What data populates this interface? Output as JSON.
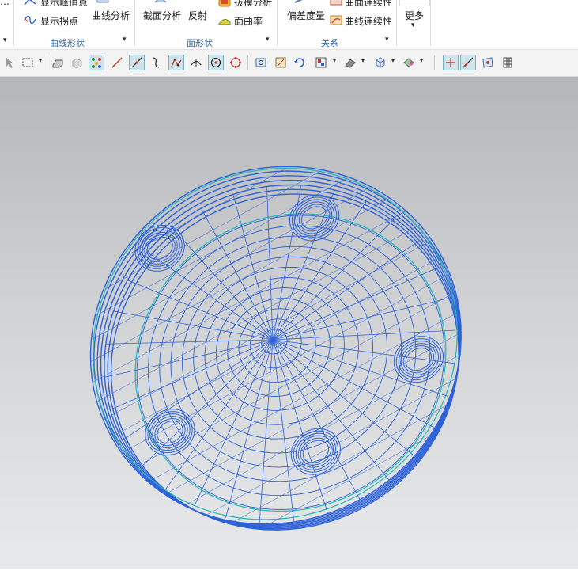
{
  "ribbon": {
    "curve_shape_group": {
      "item_peak": "显示峰值点",
      "item_inflection": "显示拐点",
      "btn_curve_analysis": "曲线分析",
      "label": "曲线形状"
    },
    "face_shape_group": {
      "btn_section": "截面分析",
      "btn_reflection": "反射",
      "item_draft": "拔模分析",
      "item_curvature": "面曲率",
      "label": "面形状"
    },
    "relation_group": {
      "btn_deviation": "偏差度量",
      "item_face_continuity": "曲面连续性",
      "item_curve_continuity": "曲线连续性",
      "label": "关系"
    },
    "more_label": "更多"
  },
  "toolbar": {
    "icons": [
      "select-arrow-icon",
      "box-select-icon",
      "shaded-edges-icon",
      "shaded-icon",
      "show-snap-icon",
      "line-icon",
      "line-tool-icon",
      "curve-icon",
      "curve-points-icon",
      "intersection-icon",
      "center-point-icon",
      "quadrant-point-icon",
      "zoom-fit-icon",
      "view-icon",
      "rotate-icon",
      "layer-icon",
      "edit-object-icon",
      "cube-view-icon",
      "render-style-icon",
      "crosshair-icon",
      "snap-line-icon",
      "perspective-icon",
      "grid-icon"
    ]
  },
  "colors": {
    "wire": "#2f62d8",
    "edge": "#27b6b2",
    "accent": "#2f6bb0",
    "toggle_bg": "#cfe4ea"
  }
}
